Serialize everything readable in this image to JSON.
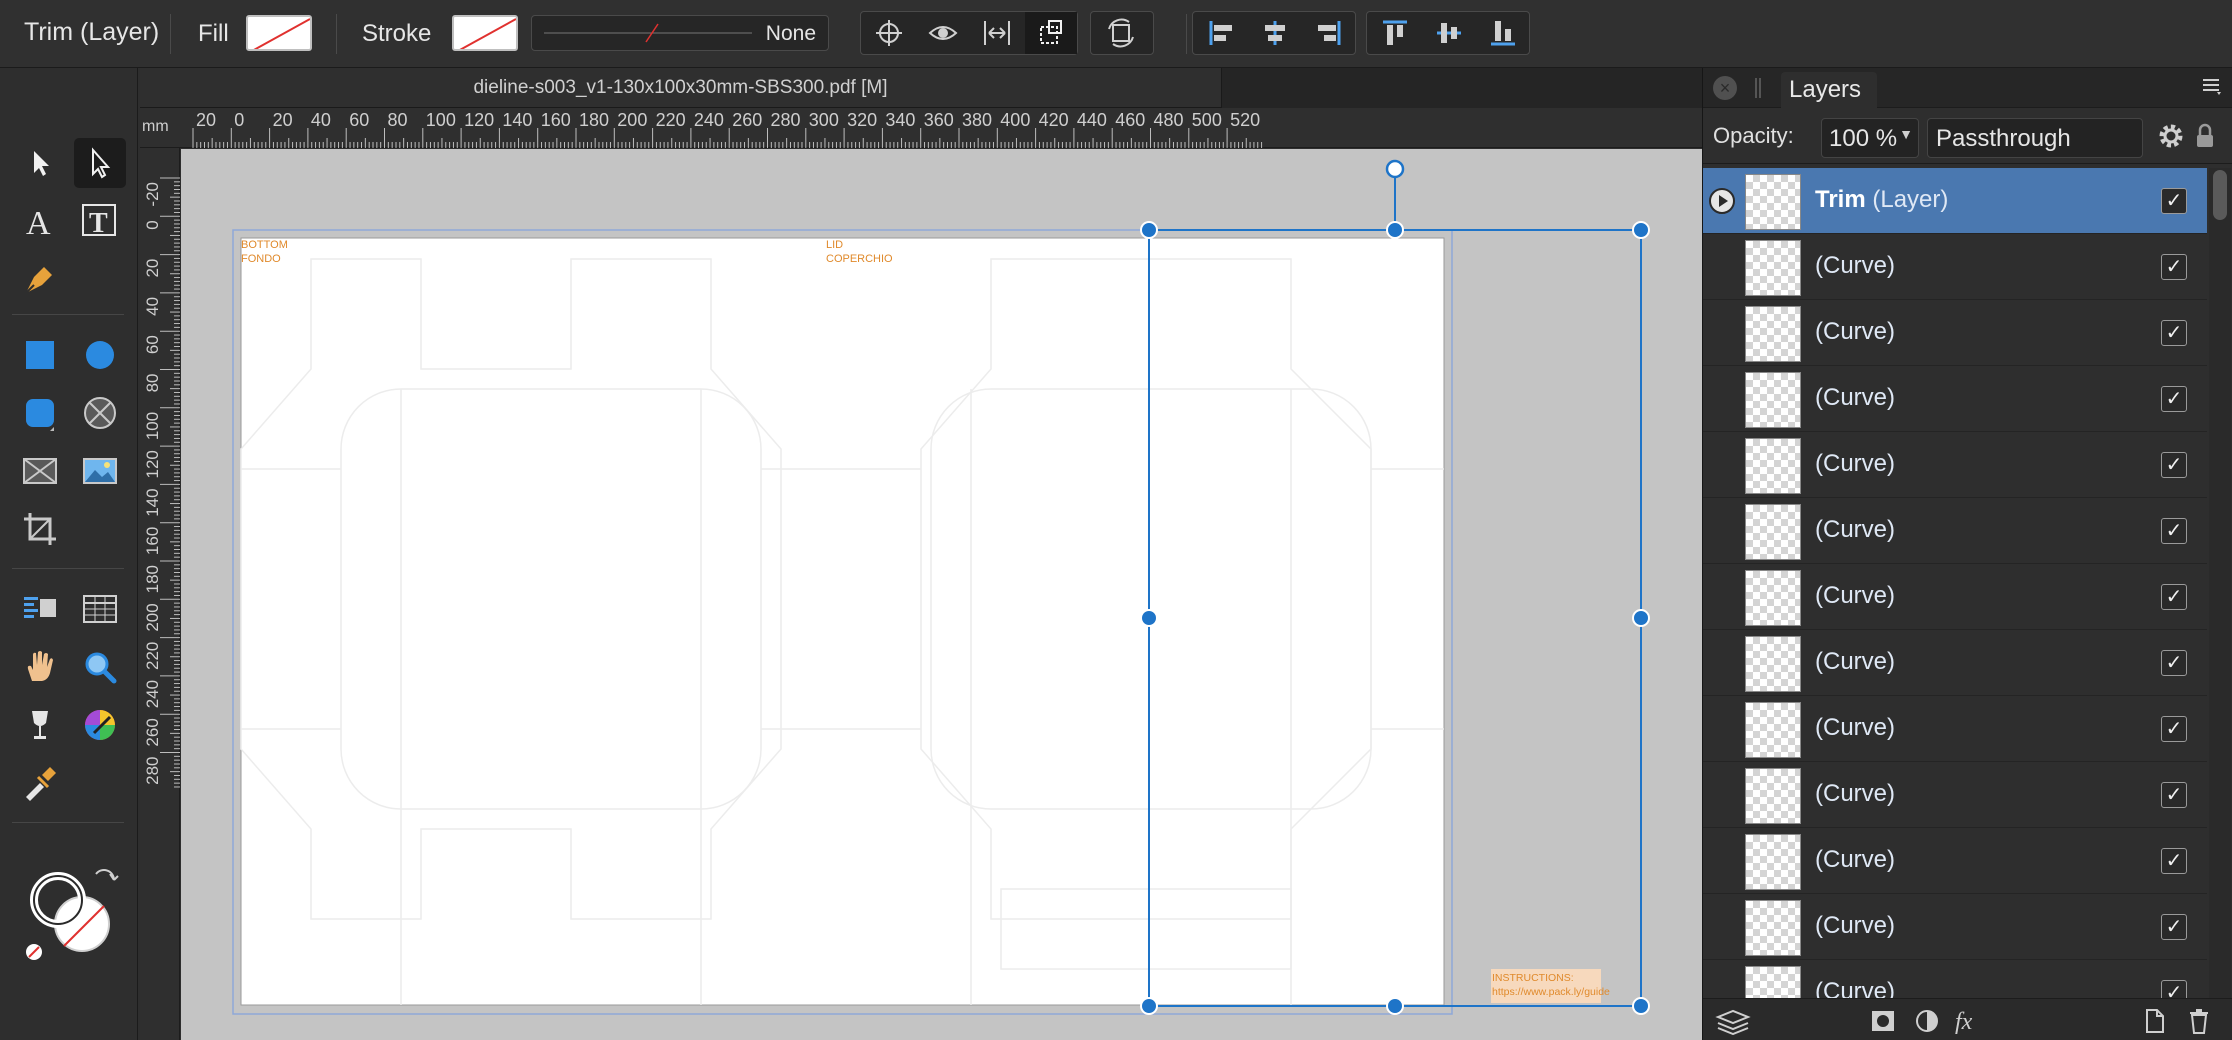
{
  "context_toolbar": {
    "title": "Trim (Layer)",
    "fill_label": "Fill",
    "stroke_label": "Stroke",
    "stroke_width_value": "None"
  },
  "document": {
    "tab_title": "dieline-s003_v1-130x100x30mm-SBS300.pdf [M]"
  },
  "ruler": {
    "unit": "mm",
    "h_labels": [
      "20",
      "0",
      "20",
      "40",
      "60",
      "80",
      "100",
      "120",
      "140",
      "160",
      "180",
      "200",
      "220",
      "240",
      "260",
      "280",
      "300",
      "320",
      "340",
      "360",
      "380",
      "400",
      "420",
      "440",
      "460",
      "480",
      "500",
      "520"
    ],
    "v_labels": [
      "-20",
      "0",
      "20",
      "40",
      "60",
      "80",
      "100",
      "120",
      "140",
      "160",
      "180",
      "200",
      "220",
      "240",
      "260",
      "280"
    ]
  },
  "artwork": {
    "bottom_label": "BOTTOM",
    "bottom_label_2": "FONDO",
    "lid_label": "LID",
    "lid_label_2": "COPERCHIO",
    "instructions_label": "INSTRUCTIONS:",
    "instructions_url": "https://www.pack.ly/guide",
    "instructions_bg": "#f7d9bd",
    "text_color": "#e08a2c",
    "selection_color": "#1e74c8"
  },
  "layers_panel": {
    "title": "Layers",
    "opacity_label": "Opacity:",
    "opacity_value": "100 %",
    "blend_mode": "Passthrough",
    "layers": [
      {
        "name": "Trim",
        "type": "(Layer)",
        "checked": "✓"
      },
      {
        "name": "",
        "type": "(Curve)",
        "checked": "✓"
      },
      {
        "name": "",
        "type": "(Curve)",
        "checked": "✓"
      },
      {
        "name": "",
        "type": "(Curve)",
        "checked": "✓"
      },
      {
        "name": "",
        "type": "(Curve)",
        "checked": "✓"
      },
      {
        "name": "",
        "type": "(Curve)",
        "checked": "✓"
      },
      {
        "name": "",
        "type": "(Curve)",
        "checked": "✓"
      },
      {
        "name": "",
        "type": "(Curve)",
        "checked": "✓"
      },
      {
        "name": "",
        "type": "(Curve)",
        "checked": "✓"
      },
      {
        "name": "",
        "type": "(Curve)",
        "checked": "✓"
      },
      {
        "name": "",
        "type": "(Curve)",
        "checked": "✓"
      },
      {
        "name": "",
        "type": "(Curve)",
        "checked": "✓"
      },
      {
        "name": "",
        "type": "(Curve)",
        "checked": "✓"
      }
    ]
  },
  "icons": {
    "tools": [
      "move-tool-icon",
      "node-tool-icon",
      "artistic-text-icon",
      "frame-text-icon",
      "pen-tool-icon",
      "rectangle-tool-icon",
      "ellipse-tool-icon",
      "rounded-rect-tool-icon",
      "donut-tool-icon",
      "picture-frame-icon",
      "image-place-icon",
      "crop-tool-icon",
      "table-text-icon",
      "table-tool-icon",
      "hand-tool-icon",
      "zoom-tool-icon",
      "fill-tool-icon",
      "color-picker-icon",
      "eyedropper-icon"
    ]
  }
}
